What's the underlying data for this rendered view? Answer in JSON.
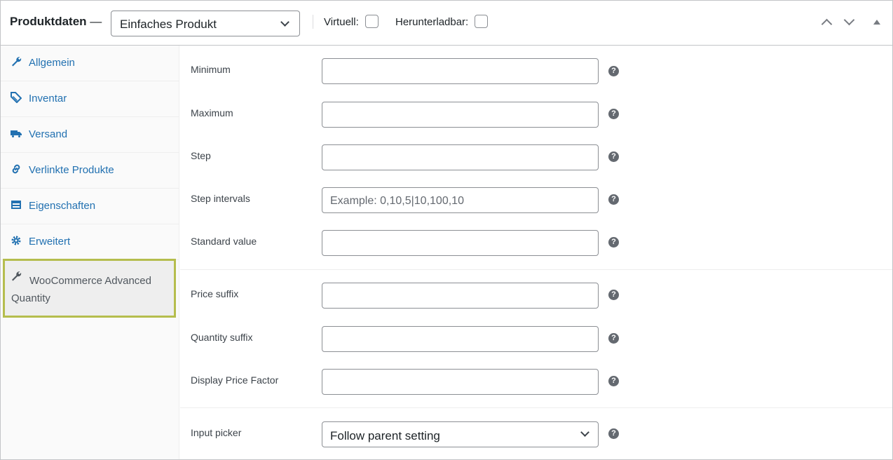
{
  "header": {
    "title": "Produktdaten",
    "dash": "—",
    "product_type": "Einfaches Produkt",
    "virtual_label": "Virtuell:",
    "downloadable_label": "Herunterladbar:"
  },
  "sidebar": {
    "tabs": [
      {
        "label": "Allgemein",
        "icon": "wrench-icon"
      },
      {
        "label": "Inventar",
        "icon": "tag-icon"
      },
      {
        "label": "Versand",
        "icon": "truck-icon"
      },
      {
        "label": "Verlinkte Produkte",
        "icon": "link-icon"
      },
      {
        "label": "Eigenschaften",
        "icon": "list-icon"
      },
      {
        "label": "Erweitert",
        "icon": "gear-icon"
      },
      {
        "label": "WooCommerce Advanced Quantity",
        "icon": "wrench-icon",
        "active": true
      }
    ]
  },
  "fields": {
    "minimum": {
      "label": "Minimum",
      "value": ""
    },
    "maximum": {
      "label": "Maximum",
      "value": ""
    },
    "step": {
      "label": "Step",
      "value": ""
    },
    "step_intervals": {
      "label": "Step intervals",
      "placeholder": "Example: 0,10,5|10,100,10"
    },
    "standard_value": {
      "label": "Standard value",
      "value": ""
    },
    "price_suffix": {
      "label": "Price suffix",
      "value": ""
    },
    "quantity_suffix": {
      "label": "Quantity suffix",
      "value": ""
    },
    "display_price_factor": {
      "label": "Display Price Factor",
      "value": ""
    },
    "input_picker": {
      "label": "Input picker",
      "value": "Follow parent setting"
    }
  },
  "help_glyph": "?",
  "colors": {
    "accent": "#2271b1",
    "active_border": "#b5bd4d"
  }
}
